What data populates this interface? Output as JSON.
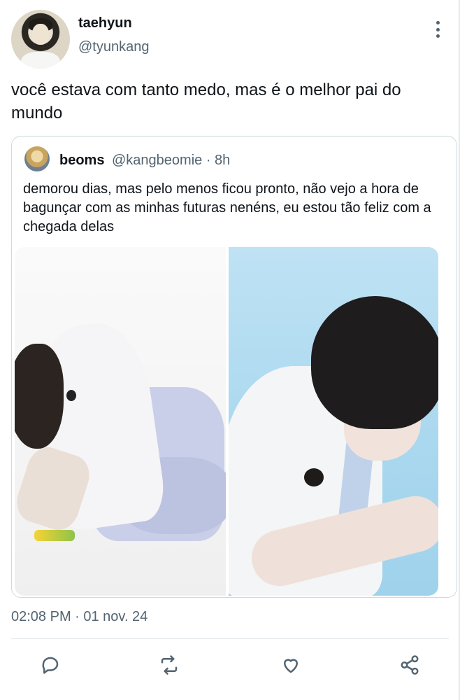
{
  "tweet": {
    "author_name": "taehyun",
    "author_handle": "@tyunkang",
    "text": "você estava com tanto medo, mas é o melhor pai do mundo",
    "timestamp": "02:08 PM · 01 nov. 24"
  },
  "quoted_tweet": {
    "author_name": "beoms",
    "meta": "@kangbeomie · 8h",
    "text": "demorou dias, mas pelo menos ficou pronto, não vejo a hora de bagunçar com as minhas futuras nenéns, eu estou tão feliz com a chegada delas"
  },
  "icons": {
    "more": "more-vertical-icon",
    "reply": "reply-icon",
    "retweet": "retweet-icon",
    "like": "heart-icon",
    "share": "share-icon"
  },
  "colors": {
    "text_primary": "#0f1419",
    "text_secondary": "#536471",
    "border": "#cfd9de"
  }
}
